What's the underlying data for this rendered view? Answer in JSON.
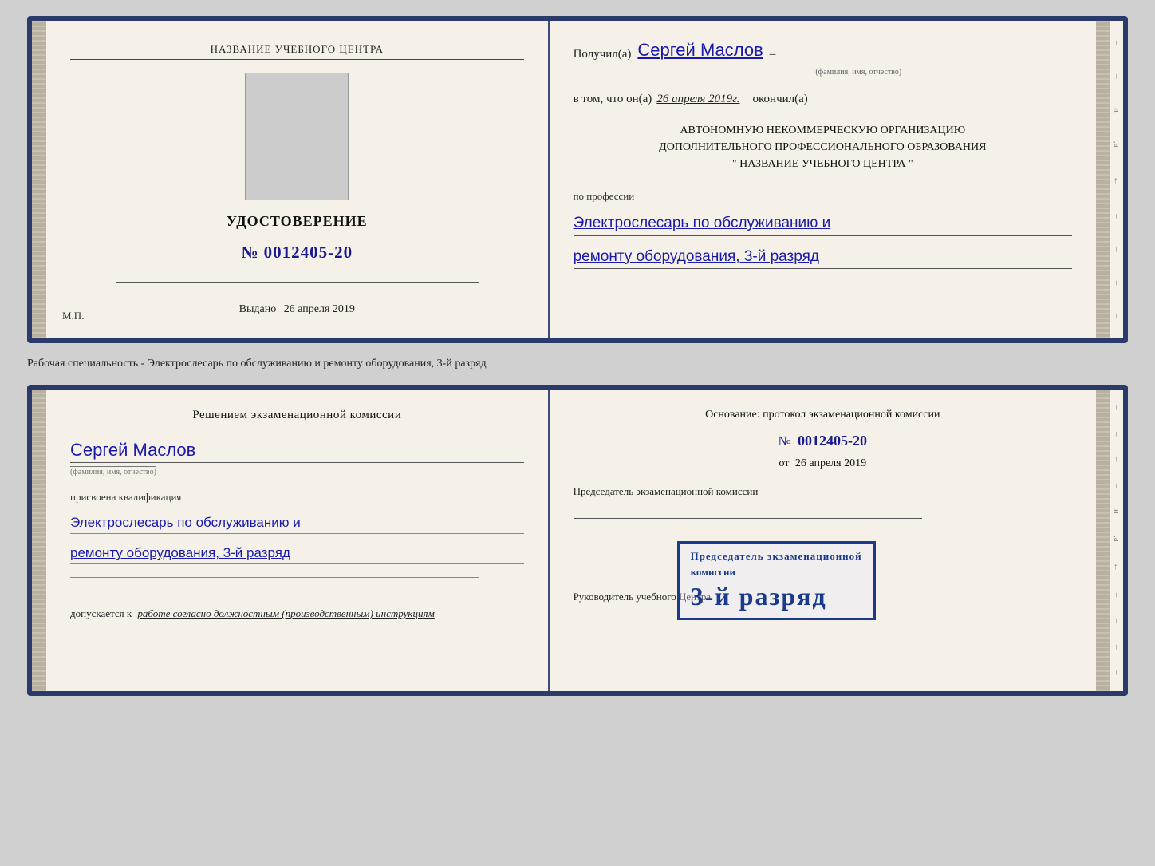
{
  "card1": {
    "left": {
      "school_name": "НАЗВАНИЕ УЧЕБНОГО ЦЕНТРА",
      "cert_title": "УДОСТОВЕРЕНИЕ",
      "cert_number_prefix": "№",
      "cert_number": "0012405-20",
      "issued_label": "Выдано",
      "issued_date": "26 апреля 2019",
      "mp_label": "М.П."
    },
    "right": {
      "received_label": "Получил(а)",
      "received_name": "Сергей Маслов",
      "fio_label": "(фамилия, имя, отчество)",
      "date_intro": "в том, что он(а)",
      "date_value": "26 апреля 2019г.",
      "finished_label": "окончил(а)",
      "org_line1": "АВТОНОМНУЮ НЕКОММЕРЧЕСКУЮ ОРГАНИЗАЦИЮ",
      "org_line2": "ДОПОЛНИТЕЛЬНОГО ПРОФЕССИОНАЛЬНОГО ОБРАЗОВАНИЯ",
      "org_name_quotes": "\"",
      "org_name": "НАЗВАНИЕ УЧЕБНОГО ЦЕНТРА",
      "org_name_quotes_end": "\"",
      "profession_label": "по профессии",
      "profession_value": "Электрослесарь по обслуживанию и",
      "profession_value2": "ремонту оборудования, 3-й разряд"
    }
  },
  "middle_text": "Рабочая специальность - Электрослесарь по обслуживанию и ремонту оборудования, 3-й разряд",
  "card2": {
    "left": {
      "commission_title": "Решением экзаменационной комиссии",
      "person_name": "Сергей Маслов",
      "fio_label": "(фамилия, имя, отчество)",
      "qualification_label": "присвоена квалификация",
      "qualification_line1": "Электрослесарь по обслуживанию и",
      "qualification_line2": "ремонту оборудования, 3-й разряд",
      "allowed_label": "допускается к",
      "allowed_value": "работе согласно должностным (производственным) инструкциям"
    },
    "right": {
      "basis_title": "Основание: протокол экзаменационной комиссии",
      "protocol_prefix": "№",
      "protocol_number": "0012405-20",
      "date_prefix": "от",
      "protocol_date": "26 апреля 2019",
      "chairman_label": "Председатель экзаменационной комиссии",
      "stamp_line1": "3-й разряд",
      "director_label": "Руководитель учебного Центра"
    }
  }
}
